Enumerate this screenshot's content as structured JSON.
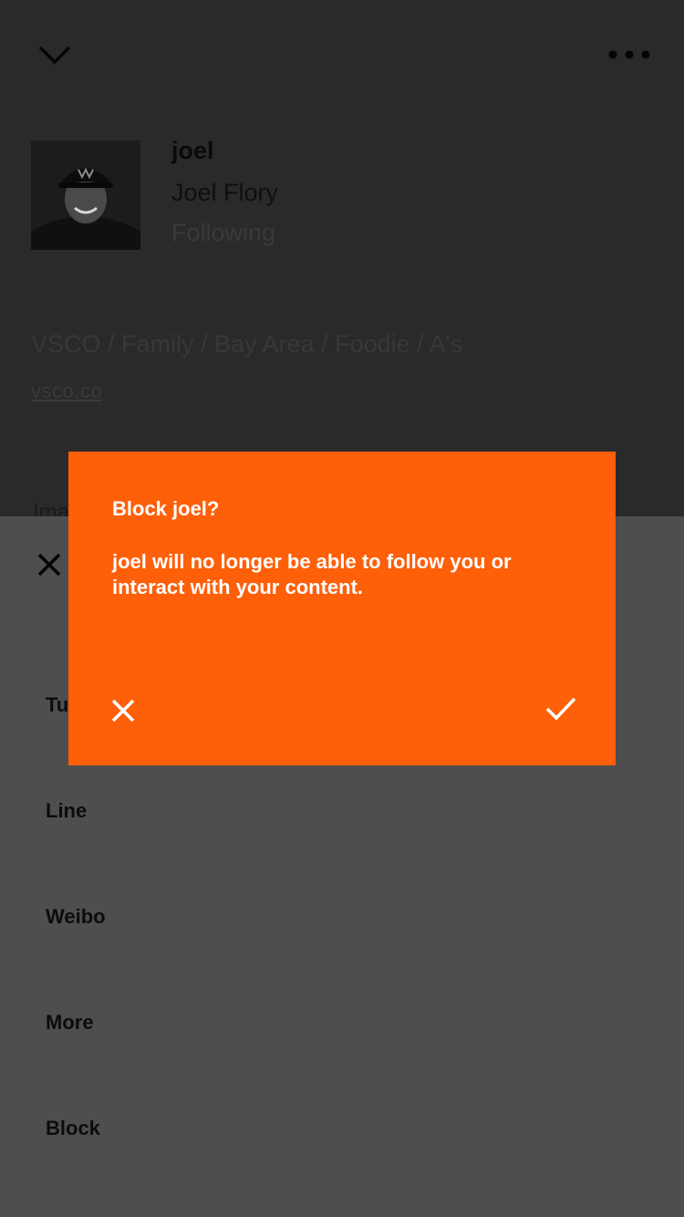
{
  "profile": {
    "username": "joel",
    "full_name": "Joel Flory",
    "follow_status": "Following",
    "bio": "VSCO / Family / Bay Area / Foodie / A's",
    "website": "vsco.co"
  },
  "icons": {
    "back": "chevron-down-icon",
    "menu": "more-dots-icon",
    "sheet_close": "close-icon",
    "dialog_cancel": "close-icon",
    "dialog_confirm": "checkmark-icon"
  },
  "share_sheet": {
    "peek_label": "Ima",
    "items": [
      {
        "label": "Tu"
      },
      {
        "label": "Line"
      },
      {
        "label": "Weibo"
      },
      {
        "label": "More"
      },
      {
        "label": "Block"
      }
    ]
  },
  "dialog": {
    "title": "Block joel?",
    "message": "joel will no longer be able to follow you or interact with your content."
  },
  "colors": {
    "dialog_background": "#fe5f09",
    "sheet_background": "#4e4e4e",
    "screen_background": "#2a2a2a"
  }
}
